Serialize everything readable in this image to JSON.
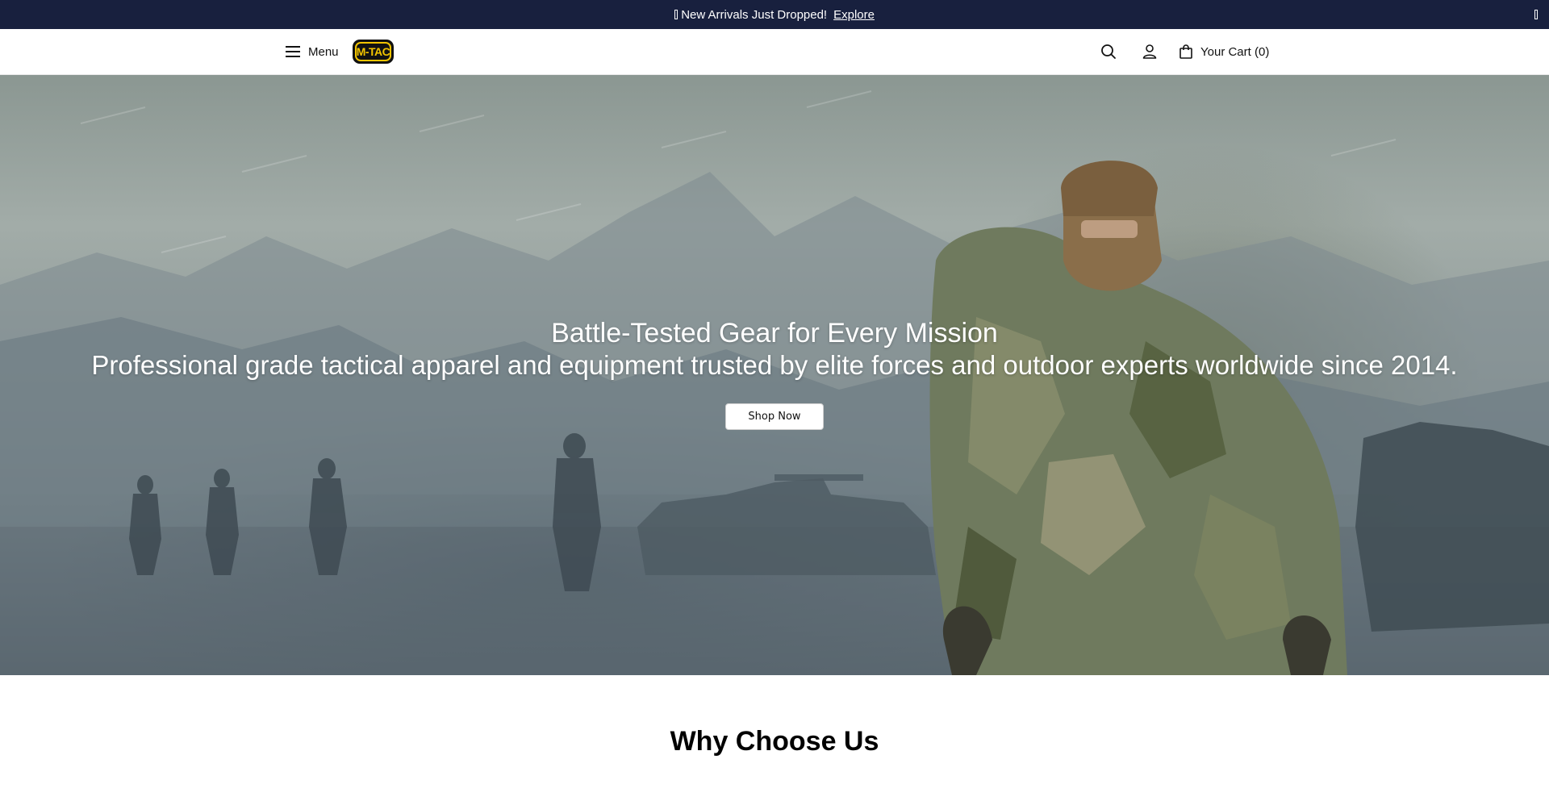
{
  "announcement": {
    "text": "New Arrivals Just Dropped!",
    "link_label": "Explore",
    "close_icon": "close-icon"
  },
  "header": {
    "menu_label": "Menu",
    "menu_icon": "hamburger-icon",
    "logo_text": "M-TAC",
    "search_icon": "search-icon",
    "account_icon": "user-icon",
    "cart_icon": "shopping-bag-icon",
    "cart_label": "Your Cart (0)"
  },
  "hero": {
    "title": "Battle-Tested Gear for Every Mission",
    "subtitle": "Professional grade tactical apparel and equipment trusted by elite forces and outdoor experts worldwide since 2014.",
    "cta_label": "Shop Now"
  },
  "section": {
    "heading": "Why Choose Us"
  },
  "colors": {
    "announcement_bg": "#18203e",
    "logo_yellow": "#f2c400",
    "header_bg": "#ffffff"
  }
}
